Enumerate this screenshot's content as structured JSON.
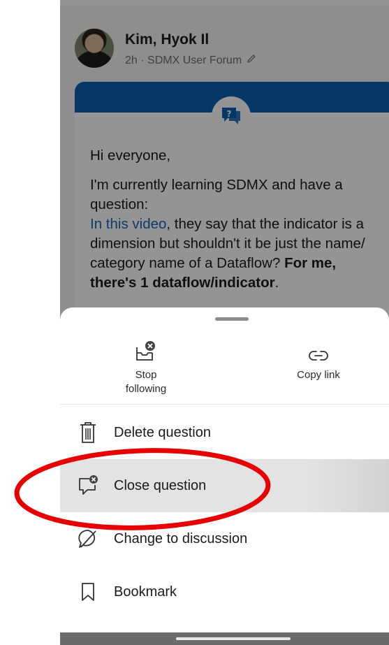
{
  "post": {
    "author": "Kim, Hyok Il",
    "meta": "2h · SDMX User Forum",
    "body": {
      "greeting": "Hi everyone,",
      "line1": "I'm currently learning SDMX and have a question:",
      "link_text": "In this video",
      "after_link": ", they say that the indicator is a dimension but shouldn't it be just the name/ category name of a Dataflow?",
      "bold_tail": "For me, there's 1 dataflow/indicator",
      "end": "."
    }
  },
  "sheet": {
    "top_actions": [
      {
        "label": "Stop following",
        "icon": "stop-following-icon"
      },
      {
        "label": "Copy link",
        "icon": "link-icon"
      }
    ],
    "items": [
      {
        "label": "Delete question",
        "icon": "trash-icon"
      },
      {
        "label": "Close question",
        "icon": "close-question-icon",
        "highlighted": true
      },
      {
        "label": "Change to discussion",
        "icon": "discussion-icon"
      },
      {
        "label": "Bookmark",
        "icon": "bookmark-icon"
      }
    ]
  },
  "colors": {
    "brand_blue": "#0b60b0",
    "link_blue": "#1565c0",
    "annotation_red": "#e60000"
  }
}
